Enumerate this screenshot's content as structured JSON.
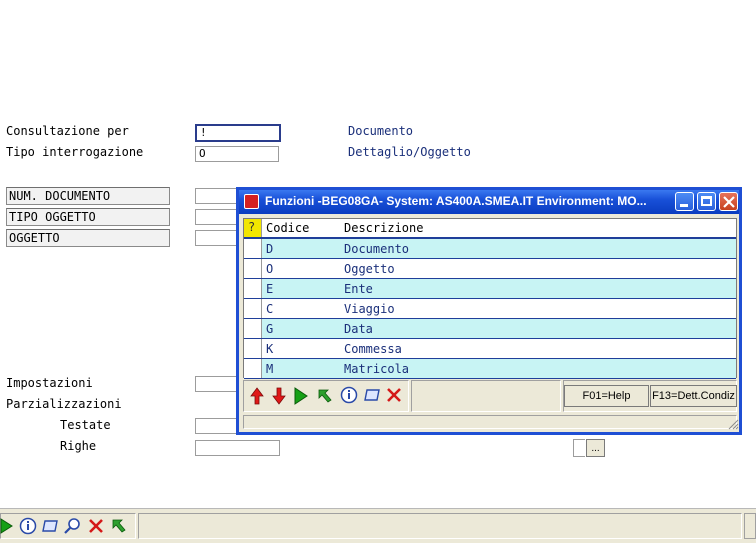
{
  "form": {
    "consultazione_label": "Consultazione per",
    "consultazione_value": "!",
    "consultazione_desc": "Documento",
    "tipo_interrogazione_label": "Tipo interrogazione",
    "tipo_interrogazione_value": "O",
    "tipo_interrogazione_desc": "Dettaglio/Oggetto",
    "boxed_labels": [
      "NUM. DOCUMENTO",
      "TIPO OGGETTO",
      "OGGETTO"
    ],
    "impostazioni_label": "Impostazioni",
    "parzializzazioni_label": "Parzializzazioni",
    "testate_label": "Testate",
    "righe_label": "Righe",
    "browse_button_label": "..."
  },
  "dialog": {
    "title": "Funzioni -BEG08GA- System: AS400A.SMEA.IT Environment: MO...",
    "columns": [
      "Codice",
      "Descrizione"
    ],
    "help_marker": "?",
    "rows": [
      {
        "code": "D",
        "desc": "Documento"
      },
      {
        "code": "O",
        "desc": "Oggetto"
      },
      {
        "code": "E",
        "desc": "Ente"
      },
      {
        "code": "C",
        "desc": "Viaggio"
      },
      {
        "code": "G",
        "desc": "Data"
      },
      {
        "code": "K",
        "desc": "Commessa"
      },
      {
        "code": "M",
        "desc": "Matricola"
      }
    ],
    "f01_label": "F01=Help",
    "f13_label": "F13=Dett.Condiz"
  },
  "colors": {
    "titlebar": "#1850d8",
    "row_highlight": "#c8f4f4",
    "value_text": "#1a2f7a",
    "grid_line": "#1f3f9a"
  }
}
